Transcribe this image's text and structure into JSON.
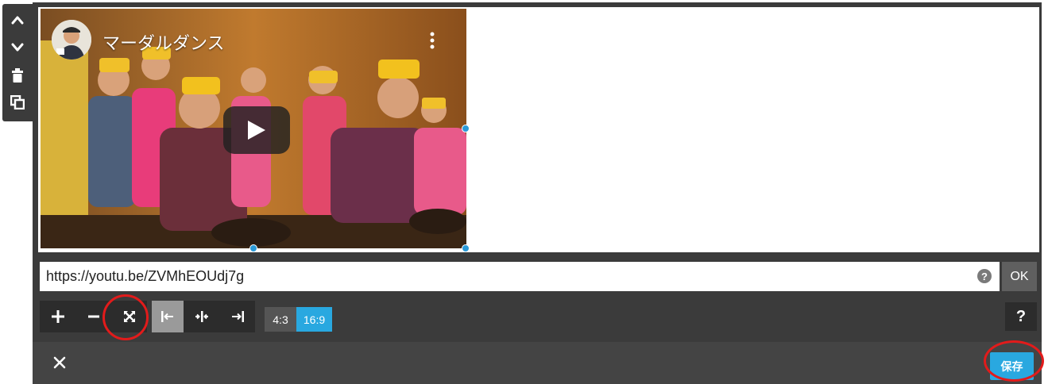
{
  "side_toolbar": {
    "icons": [
      "chevron-up-icon",
      "chevron-down-icon",
      "trash-icon",
      "duplicate-icon"
    ]
  },
  "video": {
    "channel_title": "マーダルダンス",
    "icons": [
      "avatar",
      "more-vertical-icon",
      "play-icon"
    ]
  },
  "url_row": {
    "url_value": "https://youtu.be/ZVMhEOUdj7g",
    "help_label": "?",
    "ok_label": "OK"
  },
  "toolbar": {
    "icons": [
      "zoom-in-icon",
      "zoom-out-icon",
      "fullscreen-icon",
      "align-left-icon",
      "align-center-icon",
      "align-right-icon"
    ],
    "active": "align-left",
    "ratio_4_3": "4:3",
    "ratio_16_9": "16:9",
    "selected_ratio": "16:9",
    "help_label": "?"
  },
  "bottom_bar": {
    "save_label": "保存",
    "icons": [
      "close-icon"
    ]
  },
  "colors": {
    "frame_dark": "#3b3b3b",
    "accent_blue": "#29a8e0",
    "handle_blue": "#2a9ad8",
    "annotation_red": "#e21b1b"
  }
}
